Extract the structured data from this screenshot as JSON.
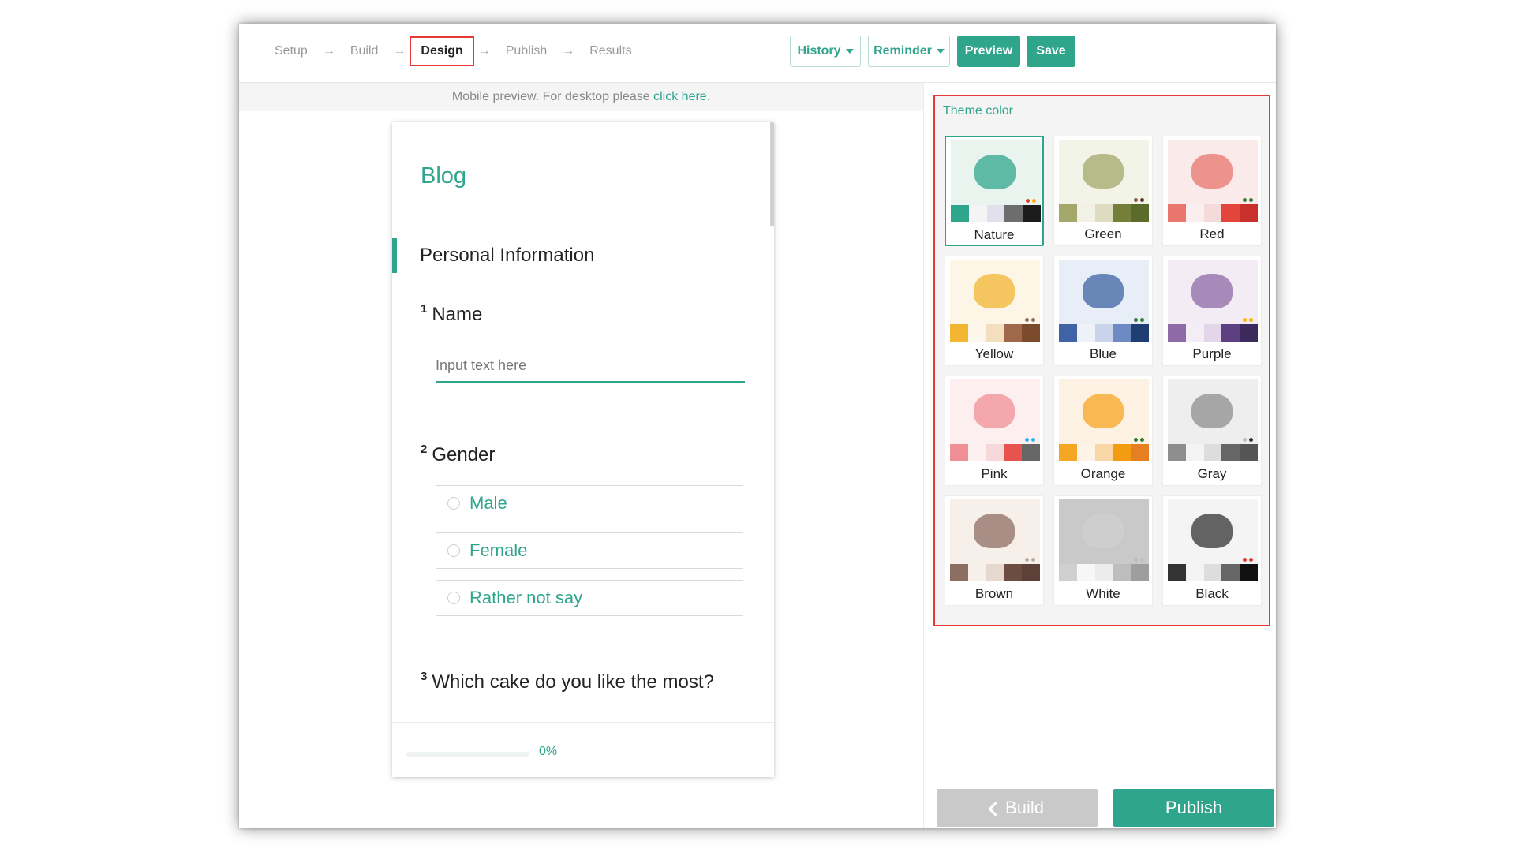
{
  "steps": {
    "setup": "Setup",
    "build": "Build",
    "design": "Design",
    "publish": "Publish",
    "results": "Results",
    "arrow": "→"
  },
  "toolbar": {
    "history": "History",
    "reminder": "Reminder",
    "preview": "Preview",
    "save": "Save"
  },
  "notice": {
    "text": "Mobile preview. For desktop please ",
    "link": "click here."
  },
  "survey": {
    "title": "Blog",
    "section": "Personal Information",
    "questions": [
      {
        "num": "1",
        "text": "Name",
        "placeholder": "Input text here"
      },
      {
        "num": "2",
        "text": "Gender",
        "options": [
          "Male",
          "Female",
          "Rather not say"
        ]
      },
      {
        "num": "3",
        "text": "Which cake do you like the most?"
      }
    ],
    "progress": {
      "value": 0,
      "label": "0%"
    }
  },
  "theme": {
    "label": "Theme color",
    "selected": "Nature",
    "colors": [
      {
        "name": "Nature",
        "bg": "#eaf4ef",
        "swatches": [
          "#2fa58c",
          "#f4f4f4",
          "#e2e0ec",
          "#6d6d6d",
          "#1b1b1b"
        ],
        "dots": [
          "#e53935",
          "#ffb300"
        ]
      },
      {
        "name": "Green",
        "bg": "#f1f4e6",
        "swatches": [
          "#a3a76a",
          "#f1f1e6",
          "#dedcc0",
          "#74803a",
          "#5b6b2b"
        ],
        "dots": [
          "#8a5a44",
          "#5b3a2e"
        ]
      },
      {
        "name": "Red",
        "bg": "#fbeaea",
        "swatches": [
          "#e8766f",
          "#fbeeee",
          "#f5dada",
          "#e3453c",
          "#c9302c"
        ],
        "dots": [
          "#2e7d32",
          "#2e7d32"
        ]
      },
      {
        "name": "Yellow",
        "bg": "#fdf5e6",
        "swatches": [
          "#f2b632",
          "#fdf6ea",
          "#f3dfbd",
          "#a0684a",
          "#7c4a2d"
        ],
        "dots": [
          "#8d6e63",
          "#8d6e63"
        ]
      },
      {
        "name": "Blue",
        "bg": "#e8eef7",
        "swatches": [
          "#3f63a4",
          "#eef1f8",
          "#c9d4ea",
          "#6d8ac4",
          "#1f3e72"
        ],
        "dots": [
          "#2e7d32",
          "#2e7d32"
        ]
      },
      {
        "name": "Purple",
        "bg": "#f4ecf4",
        "swatches": [
          "#8e6aa6",
          "#f3eef6",
          "#e3d6ea",
          "#5e3f82",
          "#3d2a5c"
        ],
        "dots": [
          "#ffb300",
          "#ffb300"
        ]
      },
      {
        "name": "Pink",
        "bg": "#fdeff0",
        "swatches": [
          "#f08f95",
          "#fdf0f1",
          "#f6d8db",
          "#e9534f",
          "#666666"
        ],
        "dots": [
          "#29b6f6",
          "#29b6f6"
        ]
      },
      {
        "name": "Orange",
        "bg": "#fdf1e4",
        "swatches": [
          "#f5a623",
          "#fdf3e6",
          "#f8d6a6",
          "#f39c12",
          "#e67e22"
        ],
        "dots": [
          "#2e7d32",
          "#2e7d32"
        ]
      },
      {
        "name": "Gray",
        "bg": "#eeeeee",
        "swatches": [
          "#8e8e8e",
          "#f4f4f4",
          "#dddddd",
          "#666666",
          "#555555"
        ],
        "dots": [
          "#bdbdbd",
          "#333333"
        ]
      },
      {
        "name": "Brown",
        "bg": "#f6efea",
        "swatches": [
          "#8d6e63",
          "#f6efea",
          "#e6d7cf",
          "#6d4c41",
          "#5d4037"
        ],
        "dots": [
          "#bcaaa4",
          "#bcaaa4"
        ]
      },
      {
        "name": "White",
        "bg": "#c9c9c9",
        "swatches": [
          "#cfcfcf",
          "#f7f7f7",
          "#ececec",
          "#bdbdbd",
          "#9e9e9e"
        ],
        "dots": [
          "#bdbdbd",
          "#bdbdbd"
        ]
      },
      {
        "name": "Black",
        "bg": "#f4f4f4",
        "swatches": [
          "#333333",
          "#f4f4f4",
          "#dddddd",
          "#666666",
          "#111111"
        ],
        "dots": [
          "#e53935",
          "#e53935"
        ]
      }
    ]
  },
  "footer": {
    "build": "Build",
    "publish": "Publish"
  }
}
